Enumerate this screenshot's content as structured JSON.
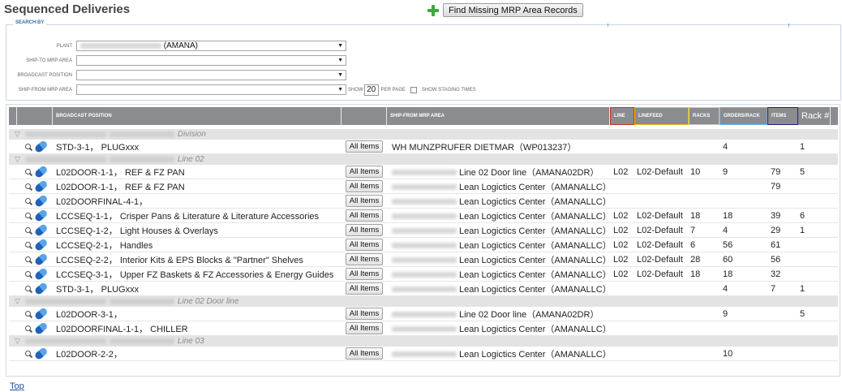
{
  "title": "Sequenced Deliveries",
  "find_button": "Find Missing MRP Area Records",
  "search": {
    "legend": "SEARCH BY",
    "plant_label": "PLANT",
    "plant_value": "(AMANA)",
    "ship_to_label": "SHIP-TO MRP AREA",
    "broadcast_label": "BROADCAST POSITION",
    "ship_from_label": "SHIP-FROM MRP AREA",
    "show_label": "SHOW",
    "show_value": "20",
    "per_page_label": "PER PAGE",
    "staging_label": "SHOW STAGING TIMES"
  },
  "headers": {
    "broadcast": "BROADCAST POSITION",
    "ship_from": "SHIP-FROM MRP AREA",
    "line": "LINE",
    "linefeed": "LINEFEED",
    "racks": "RACKS",
    "orders_rack": "ORDERS/RACK",
    "items": "ITEMS",
    "rack_num": "Rack #"
  },
  "all_items_label": "All Items",
  "groups": [
    {
      "suffix": "Division"
    },
    {
      "suffix": "Line 02"
    },
    {
      "suffix": "Line 02 Door line"
    },
    {
      "suffix": "Line 03"
    }
  ],
  "rows": [
    {
      "bp": "STD-3-1， PLUGxxx",
      "area": "WH MUNZPRUFER DIETMAR（WP013237）",
      "line": "",
      "linefeed": "",
      "racks": "",
      "opr": "4",
      "items": "",
      "rack": "1"
    },
    {
      "bp": "L02DOOR-1-1， REF & FZ PAN",
      "area": "Line 02 Door line（AMANA02DR）",
      "line": "L02",
      "linefeed": "L02-Default",
      "racks": "10",
      "opr": "9",
      "items": "79",
      "rack": "5"
    },
    {
      "bp": "L02DOOR-1-1， REF & FZ PAN",
      "area": "Lean Logictics Center（AMANALLC）",
      "line": "",
      "linefeed": "",
      "racks": "",
      "opr": "",
      "items": "79",
      "rack": ""
    },
    {
      "bp": "L02DOORFINAL-4-1，",
      "area": "Lean Logictics Center（AMANALLC）",
      "line": "",
      "linefeed": "",
      "racks": "",
      "opr": "",
      "items": "",
      "rack": ""
    },
    {
      "bp": "LCCSEQ-1-1， Crisper Pans & Literature & Literature Accessories",
      "area": "Lean Logictics Center（AMANALLC）",
      "line": "L02",
      "linefeed": "L02-Default",
      "racks": "18",
      "opr": "18",
      "items": "39",
      "rack": "6"
    },
    {
      "bp": "LCCSEQ-1-2， Light Houses & Overlays",
      "area": "Lean Logictics Center（AMANALLC）",
      "line": "L02",
      "linefeed": "L02-Default",
      "racks": "7",
      "opr": "4",
      "items": "29",
      "rack": "1"
    },
    {
      "bp": "LCCSEQ-2-1， Handles",
      "area": "Lean Logictics Center（AMANALLC）",
      "line": "L02",
      "linefeed": "L02-Default",
      "racks": "6",
      "opr": "56",
      "items": "61",
      "rack": ""
    },
    {
      "bp": "LCCSEQ-2-2， Interior Kits & EPS Blocks & \"Partner\" Shelves",
      "area": "Lean Logictics Center（AMANALLC）",
      "line": "L02",
      "linefeed": "L02-Default",
      "racks": "28",
      "opr": "60",
      "items": "56",
      "rack": ""
    },
    {
      "bp": "LCCSEQ-3-1， Upper FZ Baskets & FZ Accessories & Energy Guides",
      "area": "Lean Logictics Center（AMANALLC）",
      "line": "L02",
      "linefeed": "L02-Default",
      "racks": "18",
      "opr": "18",
      "items": "32",
      "rack": ""
    },
    {
      "bp": "STD-3-1， PLUGxxx",
      "area": "Lean Logictics Center（AMANALLC）",
      "line": "",
      "linefeed": "",
      "racks": "",
      "opr": "4",
      "items": "7",
      "rack": "1"
    },
    {
      "bp": "L02DOOR-3-1，",
      "area": "Line 02 Door line（AMANA02DR）",
      "line": "",
      "linefeed": "",
      "racks": "",
      "opr": "9",
      "items": "",
      "rack": "5"
    },
    {
      "bp": "L02DOORFINAL-1-1， CHILLER",
      "area": "Lean Logictics Center（AMANALLC）",
      "line": "",
      "linefeed": "",
      "racks": "",
      "opr": "",
      "items": "",
      "rack": ""
    },
    {
      "bp": "L02DOOR-2-2，",
      "area": "Lean Logictics Center（AMANALLC）",
      "line": "",
      "linefeed": "",
      "racks": "",
      "opr": "10",
      "items": "",
      "rack": ""
    }
  ],
  "top_link": "Top",
  "colors": {
    "header_bg": "#8a8c8f",
    "line_border": "#d62b2b",
    "linefeed_border": "#e2c21a",
    "racks_border": "#c8c8c8",
    "orders_border": "#6fb3e8",
    "items_border": "#1a2a6b"
  }
}
